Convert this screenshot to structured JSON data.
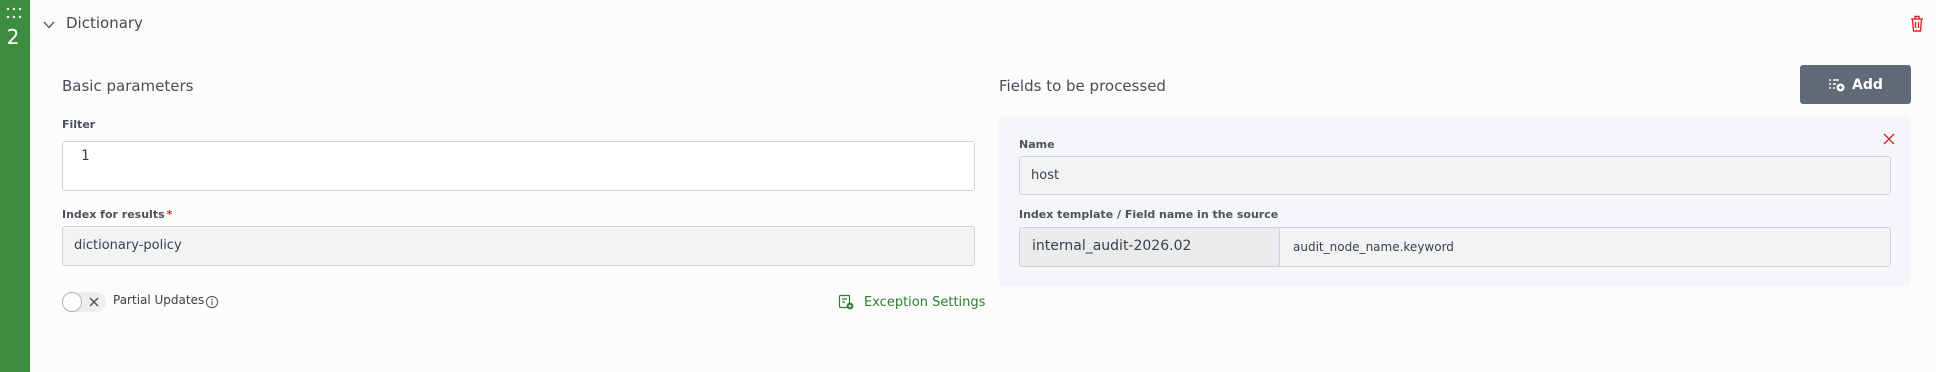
{
  "step": {
    "number": "2"
  },
  "header": {
    "title": "Dictionary"
  },
  "basic": {
    "title": "Basic parameters",
    "filter_label": "Filter",
    "filter_value": "1",
    "index_label": "Index for results",
    "index_required_mark": "*",
    "index_value": "dictionary-policy",
    "partial_updates_label": "Partial Updates",
    "partial_updates_on": false,
    "exception_settings_label": "Exception Settings"
  },
  "fields": {
    "title": "Fields to be processed",
    "add_label": "Add",
    "items": [
      {
        "name_label": "Name",
        "name_value": "host",
        "template_label": "Index template / Field name in the source",
        "template_value": "internal_audit-2026.02",
        "field_value": "audit_node_name.keyword"
      }
    ]
  },
  "colors": {
    "accent_green": "#3d8c40",
    "link_green": "#2e7d32",
    "delete_red": "#d52b2b",
    "add_button": "#5f6a76"
  },
  "icons": [
    "grip-icon",
    "chevron-down-icon",
    "trash-icon",
    "close-icon",
    "info-icon",
    "exception-settings-icon",
    "add-list-icon",
    "remove-field-icon"
  ]
}
